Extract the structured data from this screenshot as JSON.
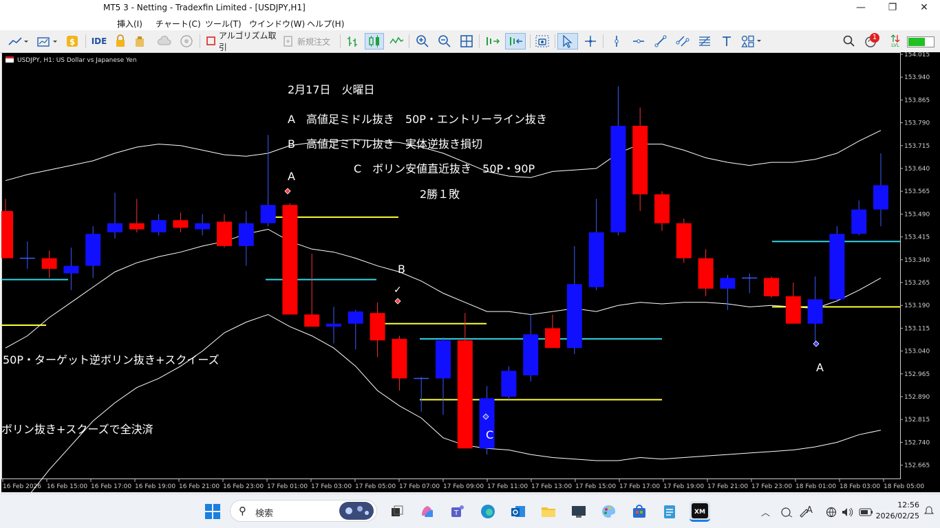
{
  "window": {
    "title": "MT5 3 - Netting - Tradexfin Limited - [USDJPY,H1]",
    "controls": {
      "minimize": "—",
      "maximize": "❐",
      "close": "✕"
    }
  },
  "menu": [
    "挿入(I)",
    "チャート(C)",
    "ツール(T)",
    "ウインドウ(W)",
    "ヘルプ(H)"
  ],
  "toolbar": {
    "ide_label": "IDE",
    "algo_label": "アルゴリズム取引",
    "new_order_label": "新規注文",
    "notification_count": "1",
    "lvl_label": "LVL"
  },
  "chart": {
    "symbol_label": "USDJPY, H1:  US Dollar vs Japanese Yen",
    "colors": {
      "bull": "#1010ff",
      "bear": "#ff0000",
      "bands": "#ffffff",
      "yellow": "#ffff33",
      "cyan": "#33d6e6",
      "background": "#000000",
      "axis": "#bbbbbb"
    },
    "annotations": {
      "date": "2月17日　火曜日",
      "line_a": "A　高値足ミドル抜き　50P・エントリーライン抜き",
      "line_b": "B　高値足ミドル抜き　実体逆抜き損切",
      "line_c": "C　ボリン安値直近抜き　50P・90P",
      "result": "2勝１敗",
      "left_note_1": "50P・ターゲット逆ボリン抜き+スクイーズ",
      "left_note_2": "ボリン抜き+スクーズで全決済",
      "marker_a1": "A",
      "marker_b": "B",
      "marker_c": "C",
      "marker_a2": "A",
      "check": "✓"
    },
    "price_axis": [
      "154.015",
      "153.940",
      "153.865",
      "153.790",
      "153.715",
      "153.640",
      "153.565",
      "153.490",
      "153.415",
      "153.340",
      "153.265",
      "153.190",
      "153.115",
      "153.040",
      "152.965",
      "152.890",
      "152.815",
      "152.740",
      "152.665"
    ],
    "time_axis": [
      "16 Feb 2026",
      "16 Feb 15:00",
      "16 Feb 17:00",
      "16 Feb 19:00",
      "16 Feb 21:00",
      "16 Feb 23:00",
      "17 Feb 01:00",
      "17 Feb 03:00",
      "17 Feb 05:00",
      "17 Feb 07:00",
      "17 Feb 09:00",
      "17 Feb 11:00",
      "17 Feb 13:00",
      "17 Feb 15:00",
      "17 Feb 17:00",
      "17 Feb 19:00",
      "17 Feb 21:00",
      "17 Feb 23:00",
      "18 Feb 01:00",
      "18 Feb 03:00",
      "18 Feb 05:00"
    ],
    "candles": [
      {
        "o": 153.5,
        "h": 153.54,
        "l": 153.345,
        "c": 153.345
      },
      {
        "o": 153.345,
        "h": 153.4,
        "l": 153.31,
        "c": 153.345
      },
      {
        "o": 153.345,
        "h": 153.37,
        "l": 153.28,
        "c": 153.31
      },
      {
        "o": 153.295,
        "h": 153.38,
        "l": 153.24,
        "c": 153.32
      },
      {
        "o": 153.32,
        "h": 153.45,
        "l": 153.28,
        "c": 153.425
      },
      {
        "o": 153.43,
        "h": 153.56,
        "l": 153.41,
        "c": 153.46
      },
      {
        "o": 153.46,
        "h": 153.54,
        "l": 153.43,
        "c": 153.44
      },
      {
        "o": 153.43,
        "h": 153.49,
        "l": 153.42,
        "c": 153.47
      },
      {
        "o": 153.47,
        "h": 153.495,
        "l": 153.43,
        "c": 153.445
      },
      {
        "o": 153.44,
        "h": 153.49,
        "l": 153.42,
        "c": 153.46
      },
      {
        "o": 153.465,
        "h": 153.49,
        "l": 153.38,
        "c": 153.385
      },
      {
        "o": 153.385,
        "h": 153.5,
        "l": 153.32,
        "c": 153.46
      },
      {
        "o": 153.46,
        "h": 153.75,
        "l": 153.45,
        "c": 153.52
      },
      {
        "o": 153.52,
        "h": 153.525,
        "l": 153.165,
        "c": 153.16
      },
      {
        "o": 153.16,
        "h": 153.36,
        "l": 153.13,
        "c": 153.12
      },
      {
        "o": 153.12,
        "h": 153.185,
        "l": 153.065,
        "c": 153.13
      },
      {
        "o": 153.13,
        "h": 153.175,
        "l": 153.045,
        "c": 153.17
      },
      {
        "o": 153.165,
        "h": 153.2,
        "l": 153.02,
        "c": 153.075
      },
      {
        "o": 153.08,
        "h": 153.09,
        "l": 152.91,
        "c": 152.95
      },
      {
        "o": 152.95,
        "h": 152.955,
        "l": 152.84,
        "c": 152.95
      },
      {
        "o": 152.95,
        "h": 153.085,
        "l": 152.83,
        "c": 153.075
      },
      {
        "o": 153.075,
        "h": 153.165,
        "l": 152.72,
        "c": 152.72
      },
      {
        "o": 152.72,
        "h": 152.925,
        "l": 152.7,
        "c": 152.885
      },
      {
        "o": 152.89,
        "h": 152.99,
        "l": 152.88,
        "c": 152.975
      },
      {
        "o": 152.96,
        "h": 153.16,
        "l": 152.94,
        "c": 153.095
      },
      {
        "o": 153.115,
        "h": 153.16,
        "l": 153.05,
        "c": 153.05
      },
      {
        "o": 153.05,
        "h": 153.385,
        "l": 153.03,
        "c": 153.26
      },
      {
        "o": 153.25,
        "h": 153.54,
        "l": 153.24,
        "c": 153.43
      },
      {
        "o": 153.43,
        "h": 153.91,
        "l": 153.42,
        "c": 153.78
      },
      {
        "o": 153.78,
        "h": 153.84,
        "l": 153.5,
        "c": 153.555
      },
      {
        "o": 153.555,
        "h": 153.565,
        "l": 153.435,
        "c": 153.46
      },
      {
        "o": 153.46,
        "h": 153.475,
        "l": 153.33,
        "c": 153.345
      },
      {
        "o": 153.345,
        "h": 153.375,
        "l": 153.22,
        "c": 153.245
      },
      {
        "o": 153.245,
        "h": 153.29,
        "l": 153.175,
        "c": 153.28
      },
      {
        "o": 153.28,
        "h": 153.295,
        "l": 153.23,
        "c": 153.28
      },
      {
        "o": 153.28,
        "h": 153.285,
        "l": 153.215,
        "c": 153.22
      },
      {
        "o": 153.22,
        "h": 153.265,
        "l": 153.145,
        "c": 153.13
      },
      {
        "o": 153.13,
        "h": 153.285,
        "l": 153.07,
        "c": 153.21
      },
      {
        "o": 153.21,
        "h": 153.45,
        "l": 153.2,
        "c": 153.425
      },
      {
        "o": 153.425,
        "h": 153.535,
        "l": 153.42,
        "c": 153.505
      },
      {
        "o": 153.505,
        "h": 153.69,
        "l": 153.45,
        "c": 153.585
      }
    ],
    "bands": {
      "upper": [
        153.6,
        153.62,
        153.635,
        153.65,
        153.665,
        153.69,
        153.71,
        153.72,
        153.715,
        153.7,
        153.685,
        153.68,
        153.69,
        153.715,
        153.725,
        153.73,
        153.735,
        153.73,
        153.725,
        153.71,
        153.69,
        153.66,
        153.63,
        153.615,
        153.61,
        153.63,
        153.635,
        153.64,
        153.69,
        153.72,
        153.72,
        153.7,
        153.675,
        153.66,
        153.65,
        153.66,
        153.66,
        153.67,
        153.69,
        153.73,
        153.765
      ],
      "middle": [
        153.05,
        153.09,
        153.15,
        153.2,
        153.25,
        153.3,
        153.33,
        153.35,
        153.365,
        153.385,
        153.4,
        153.425,
        153.44,
        153.4,
        153.375,
        153.365,
        153.345,
        153.32,
        153.3,
        153.27,
        153.23,
        153.2,
        153.17,
        153.17,
        153.16,
        153.17,
        153.18,
        153.17,
        153.19,
        153.2,
        153.195,
        153.2,
        153.2,
        153.195,
        153.185,
        153.19,
        153.185,
        153.18,
        153.205,
        153.24,
        153.28
      ],
      "lower": [
        152.51,
        152.56,
        152.65,
        152.73,
        152.81,
        152.87,
        152.92,
        152.95,
        152.99,
        153.04,
        153.1,
        153.135,
        153.16,
        153.12,
        153.09,
        153.05,
        152.99,
        152.91,
        152.86,
        152.82,
        152.755,
        152.73,
        152.72,
        152.715,
        152.7,
        152.69,
        152.685,
        152.68,
        152.68,
        152.69,
        152.685,
        152.69,
        152.695,
        152.7,
        152.705,
        152.71,
        152.715,
        152.725,
        152.74,
        152.765,
        152.78
      ]
    }
  },
  "taskbar": {
    "search_label": "検索",
    "time": "12:56",
    "date": "2026/02/25",
    "tray_ime": "A"
  }
}
